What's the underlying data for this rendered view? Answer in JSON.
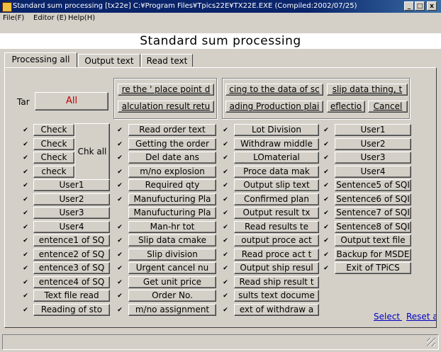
{
  "window": {
    "title": "Standard sum processing  [tx22e]  C:¥Program Files¥Tpics22E¥TX22E.EXE (Compiled:2002/07/25)",
    "controls": [
      "_",
      "□",
      "x"
    ]
  },
  "menu": {
    "file": "File(F)",
    "editor": "Editor (E)",
    "help": "Help(H)"
  },
  "header": {
    "title": "Standard sum processing"
  },
  "tabs": [
    {
      "label": "Processing all"
    },
    {
      "label": "Output text"
    },
    {
      "label": "Read text"
    }
  ],
  "target": {
    "label": "Tar",
    "all_button": "All"
  },
  "top_buttons": {
    "g1": [
      "re the ' place point d",
      "alculation result retu"
    ],
    "g2": [
      "cing to the data of sc",
      "ading Production plai"
    ],
    "g3": [
      "slip data thing, t",
      "eflectio"
    ],
    "cancel": "Cancel"
  },
  "chk_all": "Chk all",
  "col1": [
    {
      "label": "Check",
      "checked": true
    },
    {
      "label": "Check",
      "checked": true
    },
    {
      "label": "Check",
      "checked": true
    },
    {
      "label": "check",
      "checked": true
    },
    {
      "label": "User1",
      "checked": true
    },
    {
      "label": "User2",
      "checked": true
    },
    {
      "label": "User3",
      "checked": true
    },
    {
      "label": "User4",
      "checked": true
    },
    {
      "label": "entence1 of SQ",
      "checked": true
    },
    {
      "label": "entence2 of SQ",
      "checked": true
    },
    {
      "label": "entence3 of SQ",
      "checked": true
    },
    {
      "label": "entence4 of SQ",
      "checked": true
    },
    {
      "label": "Text file read",
      "checked": true
    },
    {
      "label": "Reading of sto",
      "checked": true
    }
  ],
  "col2": [
    {
      "label": "Read order text",
      "checked": true
    },
    {
      "label": "Getting the order",
      "checked": true
    },
    {
      "label": "Del date ans",
      "checked": true
    },
    {
      "label": "m/no explosion",
      "checked": true
    },
    {
      "label": "Required qty",
      "checked": true
    },
    {
      "label": "Manufucturing Pla",
      "checked": true
    },
    {
      "label": "Manufucturing Pla",
      "checked": false
    },
    {
      "label": "Man-hr tot",
      "checked": true
    },
    {
      "label": "Slip data cmake",
      "checked": true
    },
    {
      "label": "Slip division",
      "checked": true
    },
    {
      "label": "Urgent cancel nu",
      "checked": true
    },
    {
      "label": "Get unit price",
      "checked": true
    },
    {
      "label": "Order No.",
      "checked": true
    },
    {
      "label": "m/no assignment",
      "checked": true
    }
  ],
  "col3": [
    {
      "label": "Lot Division",
      "checked": true
    },
    {
      "label": "Withdraw middle",
      "checked": true
    },
    {
      "label": "LOmaterial",
      "checked": true
    },
    {
      "label": "Proce data mak",
      "checked": true
    },
    {
      "label": "Output slip text",
      "checked": true
    },
    {
      "label": "Confirmed plan",
      "checked": true
    },
    {
      "label": "Output result tx",
      "checked": true
    },
    {
      "label": "Read results te",
      "checked": true
    },
    {
      "label": "output proce act",
      "checked": true
    },
    {
      "label": "Read proce act t",
      "checked": true
    },
    {
      "label": "Output ship resul",
      "checked": true
    },
    {
      "label": "Read ship result t",
      "checked": true
    },
    {
      "label": "sults text docume",
      "checked": true
    },
    {
      "label": "ext of withdraw a",
      "checked": true
    }
  ],
  "col4": [
    {
      "label": "User1",
      "checked": true
    },
    {
      "label": "User2",
      "checked": true
    },
    {
      "label": "User3",
      "checked": true
    },
    {
      "label": "User4",
      "checked": true
    },
    {
      "label": "Sentence5 of SQI",
      "checked": true
    },
    {
      "label": "Sentence6 of SQI",
      "checked": true
    },
    {
      "label": "Sentence7 of SQI",
      "checked": true
    },
    {
      "label": "Sentence8 of SQI",
      "checked": true
    },
    {
      "label": "Output text file",
      "checked": true
    },
    {
      "label": "Backup for MSDE",
      "checked": true
    },
    {
      "label": "Exit of TPiCS",
      "checked": true
    }
  ],
  "links": {
    "select_all": "Select a",
    "reset_all": "Reset a"
  }
}
